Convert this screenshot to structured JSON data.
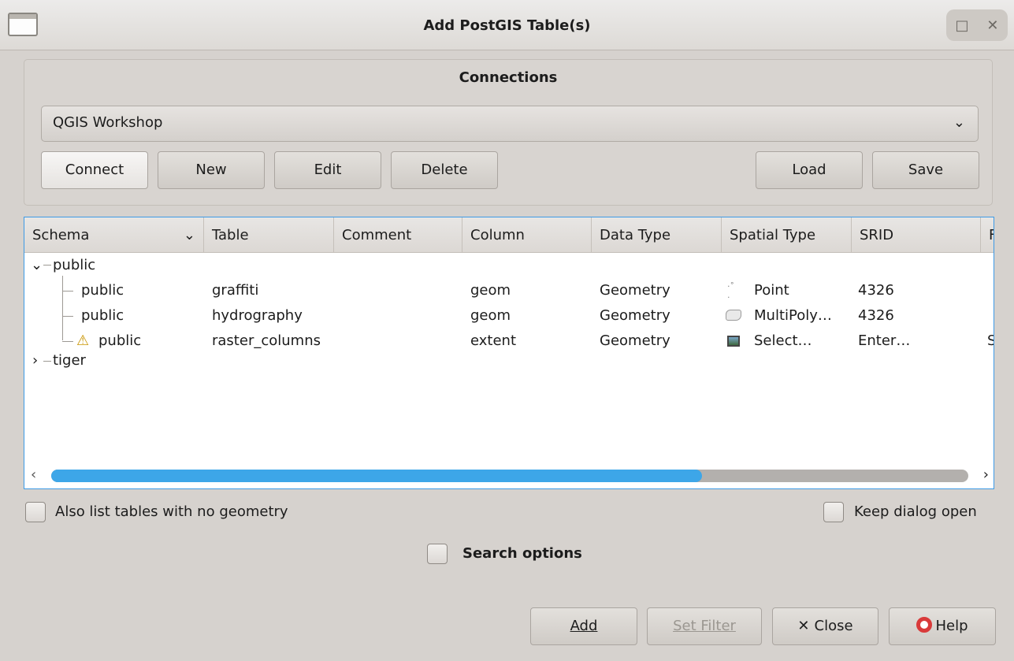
{
  "window": {
    "title": "Add PostGIS Table(s)",
    "buttons": [
      "□",
      "✕"
    ]
  },
  "connections": {
    "group_title": "Connections",
    "selected": "QGIS Workshop",
    "buttons": {
      "connect": "Connect",
      "new": "New",
      "edit": "Edit",
      "delete": "Delete",
      "load": "Load",
      "save": "Save"
    }
  },
  "table": {
    "columns": [
      "Schema",
      "Table",
      "Comment",
      "Column",
      "Data Type",
      "Spatial Type",
      "SRID",
      "F"
    ],
    "groups": [
      {
        "name": "public",
        "expanded": true,
        "rows": [
          {
            "schema": "public",
            "table": "graffiti",
            "comment": "",
            "column": "geom",
            "data_type": "Geometry",
            "spatial_type": "Point",
            "srid": "4326",
            "extra": "",
            "warning": false,
            "icon": "point-icon"
          },
          {
            "schema": "public",
            "table": "hydrography",
            "comment": "",
            "column": "geom",
            "data_type": "Geometry",
            "spatial_type": "MultiPoly…",
            "srid": "4326",
            "extra": "",
            "warning": false,
            "icon": "polygon-icon"
          },
          {
            "schema": "public",
            "table": "raster_columns",
            "comment": "",
            "column": "extent",
            "data_type": "Geometry",
            "spatial_type": "Select…",
            "srid": "Enter…",
            "extra": "S",
            "warning": true,
            "icon": "raster-icon"
          }
        ]
      },
      {
        "name": "tiger",
        "expanded": false,
        "rows": []
      }
    ],
    "scroll_position": 0.71
  },
  "options": {
    "no_geometry": {
      "label": "Also list tables with no geometry",
      "checked": false
    },
    "keep_open": {
      "label": "Keep dialog open",
      "checked": false
    },
    "search": {
      "label": "Search options",
      "checked": false
    }
  },
  "footer": {
    "add": "Add",
    "set_filter": "Set Filter",
    "close": "Close",
    "help": "Help"
  },
  "colors": {
    "accent": "#3da6e8",
    "selection_border": "#3d9ae6",
    "background": "#d6d2ce"
  }
}
